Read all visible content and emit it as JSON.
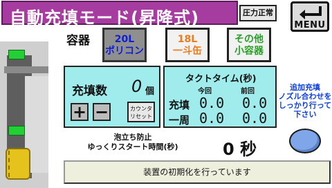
{
  "header": {
    "title": "自動充填モード(昇降式)",
    "pressure_label": "圧力正常",
    "menu_label": "MENU"
  },
  "container_select": {
    "label": "容器",
    "options": [
      {
        "line1": "20L",
        "line2": "ポリコン",
        "selected": true
      },
      {
        "line1": "18L",
        "line2": "一斗缶",
        "selected": false
      },
      {
        "line1": "その他",
        "line2": "小容器",
        "selected": false
      }
    ]
  },
  "fill_count": {
    "label": "充填数",
    "value": "0",
    "unit": "個",
    "plus_label": "+",
    "minus_label": "−",
    "reset_line1": "カウンタ",
    "reset_line2": "リセット"
  },
  "tact_time": {
    "title": "タクトタイム(秒)",
    "col_current": "今回",
    "col_previous": "前回",
    "row_fill": {
      "label": "充填",
      "current": "0.0",
      "previous": "0.0"
    },
    "row_cycle": {
      "label": "一周",
      "current": "0.0",
      "previous": "0.0"
    }
  },
  "hint": {
    "line1": "追加充填",
    "line2": "ノズル合わせを",
    "line3": "しっかり行って",
    "line4": "下さい"
  },
  "bubble_prevention": {
    "line1": "泡立ち防止",
    "line2": "ゆっくりスタート時間(秒)",
    "value": "0",
    "unit": "秒"
  },
  "status": {
    "message": "装置の初期化を行っています"
  },
  "colors": {
    "title_bg": "#a63ca0",
    "panel_bg": "#a0ecec",
    "led_green": "#22d036",
    "tank_yellow": "#e6c21c"
  }
}
